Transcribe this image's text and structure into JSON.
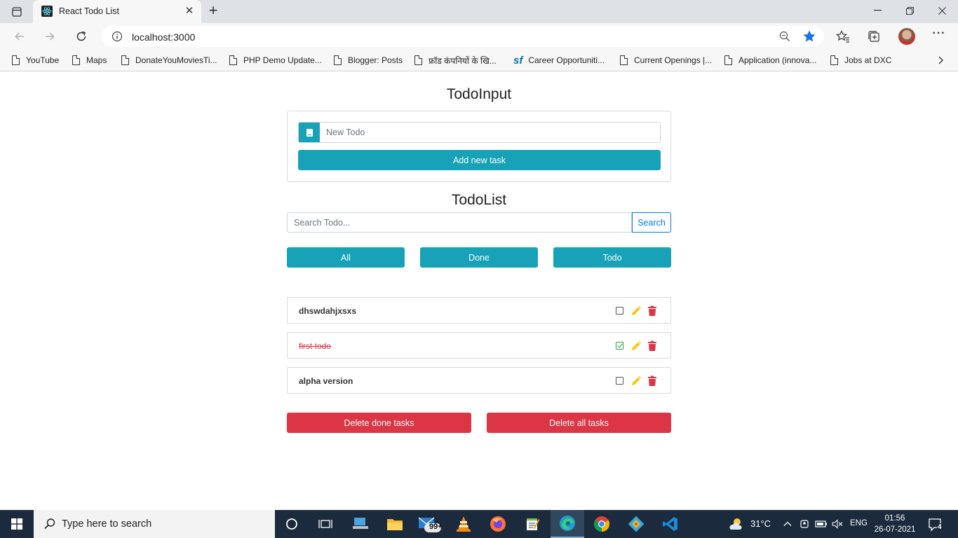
{
  "browser": {
    "tab_title": "React Todo List",
    "url": "localhost:3000",
    "bookmarks": [
      {
        "label": "YouTube"
      },
      {
        "label": "Maps"
      },
      {
        "label": "DonateYouMoviesTi..."
      },
      {
        "label": "PHP Demo Update..."
      },
      {
        "label": "Blogger: Posts"
      },
      {
        "label": "फ्रॉड कंपनियों के खि..."
      },
      {
        "label": "Career Opportuniti..."
      },
      {
        "label": "Current Openings |..."
      },
      {
        "label": "Application (innova..."
      },
      {
        "label": "Jobs at DXC"
      }
    ],
    "accent": "#1a73e8"
  },
  "todo_input": {
    "heading": "TodoInput",
    "placeholder": "New Todo",
    "value": "",
    "add_label": "Add new task"
  },
  "todo_list": {
    "heading": "TodoList",
    "search_placeholder": "Search Todo...",
    "search_value": "",
    "search_label": "Search",
    "filters": [
      {
        "label": "All"
      },
      {
        "label": "Done"
      },
      {
        "label": "Todo"
      }
    ],
    "items": [
      {
        "text": "dhswdahjxsxs",
        "done": false
      },
      {
        "text": "first todo",
        "done": true
      },
      {
        "text": "alpha version",
        "done": false
      }
    ],
    "delete_done_label": "Delete done tasks",
    "delete_all_label": "Delete all tasks"
  },
  "colors": {
    "info": "#17a2b8",
    "danger": "#dc3545",
    "primary": "#007bff",
    "success": "#28a745",
    "warning": "#ffc107"
  },
  "taskbar": {
    "search_placeholder": "Type here to search",
    "mail_badge": "99+",
    "temperature": "31°C",
    "language": "ENG",
    "time": "01:56",
    "date": "26-07-2021",
    "notification_count": "4"
  }
}
